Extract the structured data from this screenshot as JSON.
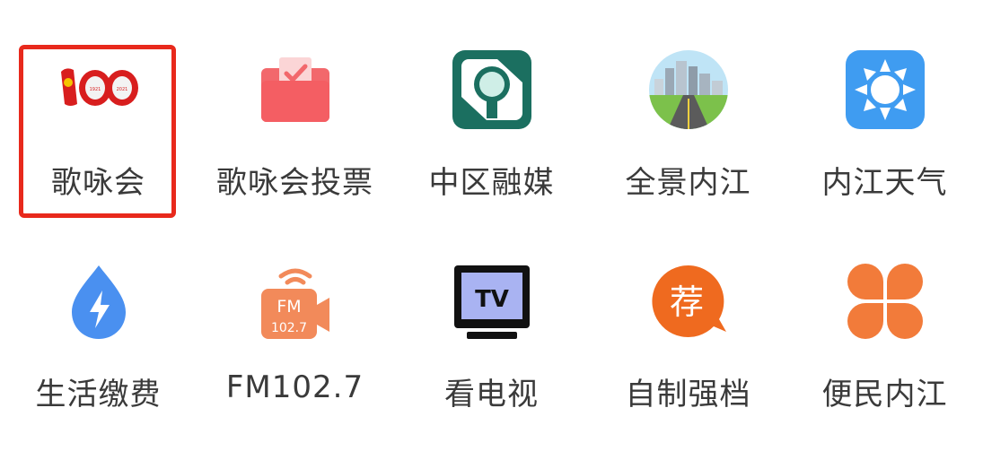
{
  "row1": [
    {
      "label": "歌咏会",
      "icon": "centenary-100-icon",
      "selected": true,
      "icon_text": "100"
    },
    {
      "label": "歌咏会投票",
      "icon": "vote-ballot-icon"
    },
    {
      "label": "中区融媒",
      "icon": "media-magnifier-icon"
    },
    {
      "label": "全景内江",
      "icon": "city-panorama-icon"
    },
    {
      "label": "内江天气",
      "icon": "weather-sun-icon"
    }
  ],
  "row2": [
    {
      "label": "生活缴费",
      "icon": "utility-payment-drop-icon"
    },
    {
      "label": "FM102.7",
      "icon": "fm-radio-icon",
      "icon_text_top": "FM",
      "icon_text_bottom": "102.7"
    },
    {
      "label": "看电视",
      "icon": "tv-icon",
      "icon_text": "TV"
    },
    {
      "label": "自制强档",
      "icon": "recommend-bubble-icon",
      "icon_text": "荐"
    },
    {
      "label": "便民内江",
      "icon": "clover-services-icon"
    }
  ],
  "colors": {
    "selection_border": "#e8291c",
    "label_text": "#3a3a3a"
  }
}
